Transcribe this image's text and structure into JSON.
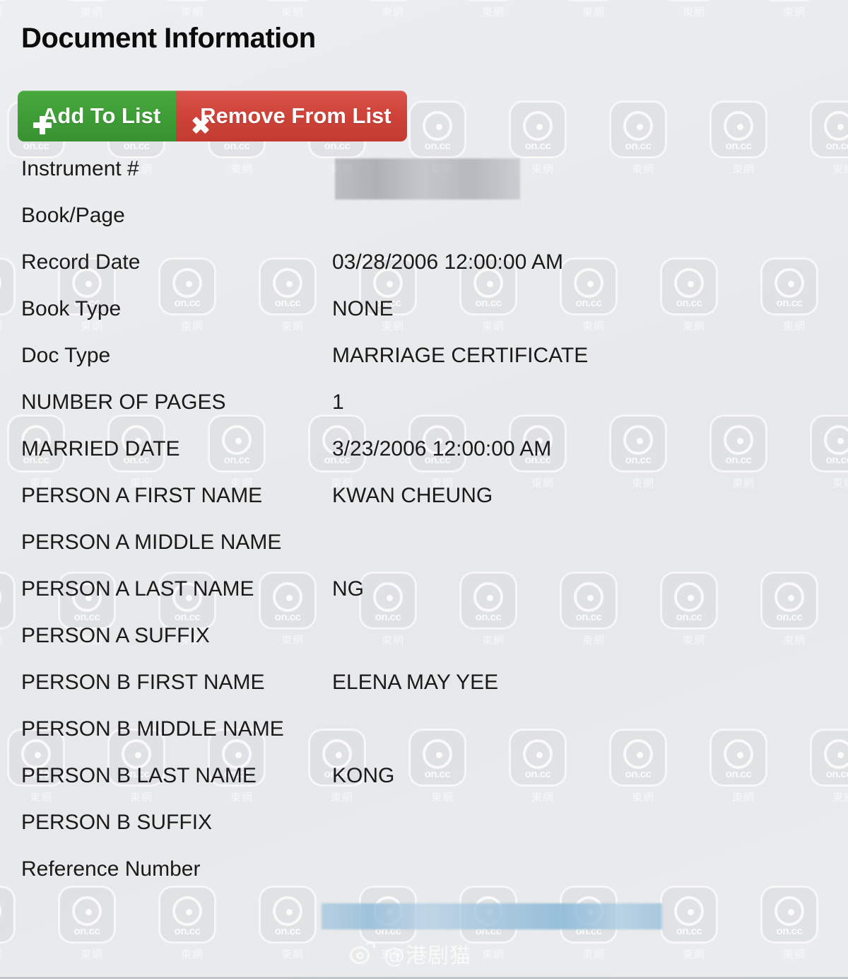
{
  "header": {
    "title": "Document Information"
  },
  "toolbar": {
    "add_label": "Add To List",
    "add_icon": "plus-icon",
    "add_color": "#3f9e36",
    "remove_label": "Remove From List",
    "remove_icon": "x-icon",
    "remove_color": "#cf4339"
  },
  "fields": [
    {
      "label": "Instrument #",
      "value": "",
      "redacted": true,
      "redaction_color": "#94979e"
    },
    {
      "label": "Book/Page",
      "value": "",
      "redacted": false
    },
    {
      "label": "Record Date",
      "value": "03/28/2006 12:00:00 AM",
      "redacted": false
    },
    {
      "label": "Book Type",
      "value": "NONE",
      "redacted": false
    },
    {
      "label": "Doc Type",
      "value": "MARRIAGE CERTIFICATE",
      "redacted": false
    },
    {
      "label": "NUMBER OF PAGES",
      "value": "1",
      "redacted": false
    },
    {
      "label": "MARRIED DATE",
      "value": "3/23/2006 12:00:00 AM",
      "redacted": false
    },
    {
      "label": "PERSON A FIRST NAME",
      "value": "KWAN CHEUNG",
      "redacted": false
    },
    {
      "label": "PERSON A MIDDLE NAME",
      "value": "",
      "redacted": false
    },
    {
      "label": "PERSON A LAST NAME",
      "value": "NG",
      "redacted": false
    },
    {
      "label": "PERSON A SUFFIX",
      "value": "",
      "redacted": false
    },
    {
      "label": "PERSON B FIRST NAME",
      "value": "ELENA MAY YEE",
      "redacted": false
    },
    {
      "label": "PERSON B MIDDLE NAME",
      "value": "",
      "redacted": false
    },
    {
      "label": "PERSON B LAST NAME",
      "value": "KONG",
      "redacted": false
    },
    {
      "label": "PERSON B SUFFIX",
      "value": "",
      "redacted": false
    },
    {
      "label": "Reference Number",
      "value": "",
      "redacted": true,
      "redaction_color": "#9ec3da"
    }
  ],
  "watermark": {
    "brand_text": "on.cc",
    "brand_cn": "東網",
    "icon": "oncc-lens-icon"
  },
  "weibo_watermark": {
    "handle": "@港剧猫",
    "icon": "weibo-logo-icon"
  }
}
